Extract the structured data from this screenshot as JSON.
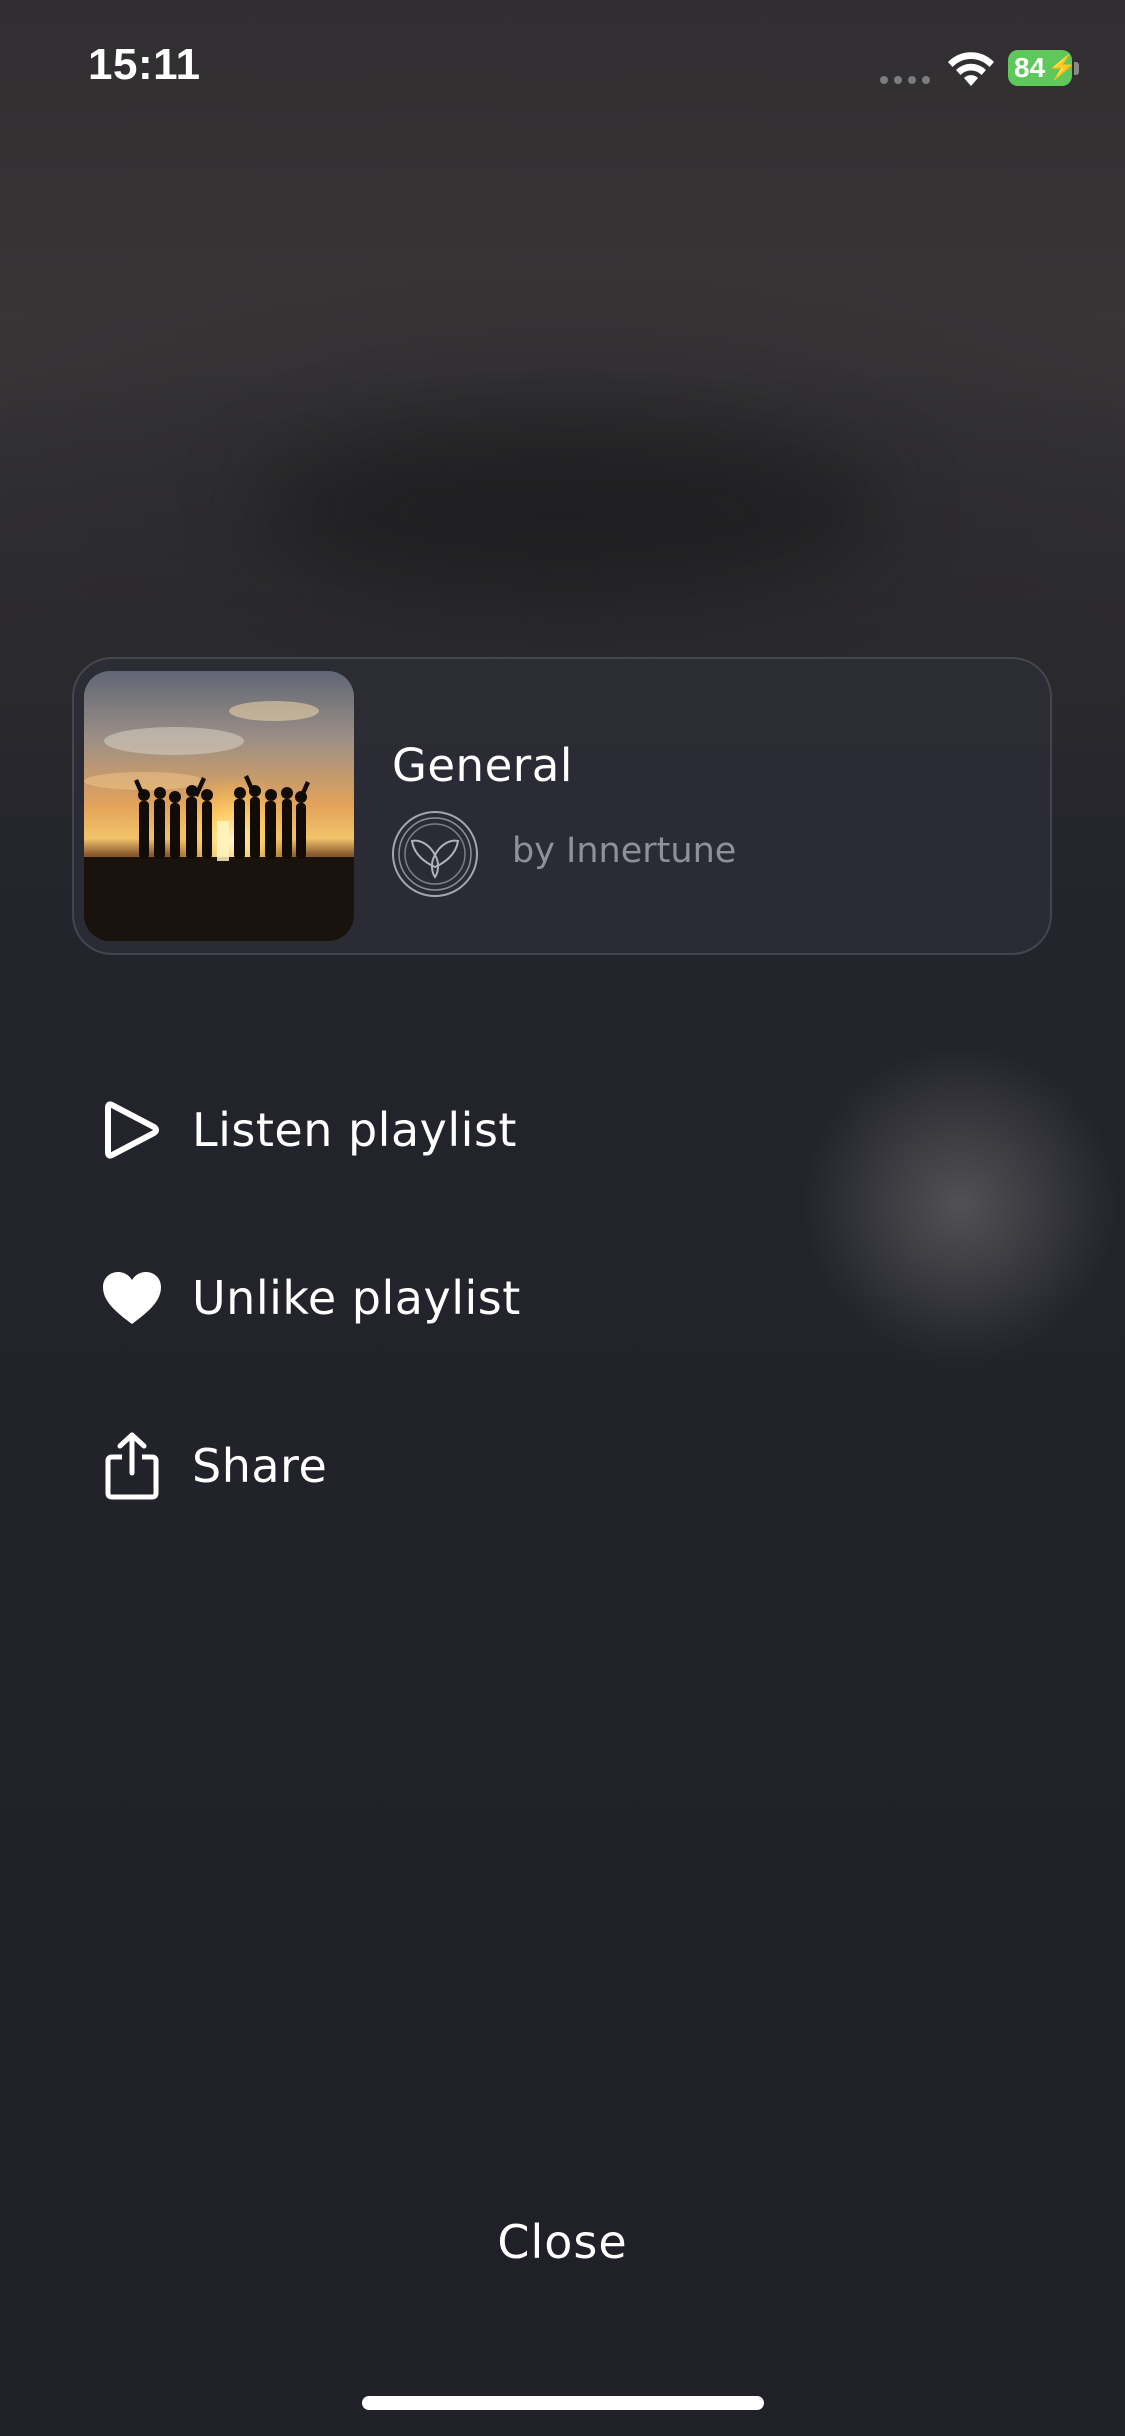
{
  "status_bar": {
    "time": "15:11",
    "battery_level": "84"
  },
  "playlist_card": {
    "title": "General",
    "author": "by Innertune",
    "thumbnail_icon": "sunset-group-photo",
    "avatar_icon": "innertune-logo-icon"
  },
  "menu": {
    "items": [
      {
        "label": "Listen playlist",
        "icon": "play-icon"
      },
      {
        "label": "Unlike playlist",
        "icon": "heart-icon"
      },
      {
        "label": "Share",
        "icon": "share-icon"
      }
    ]
  },
  "footer": {
    "close_label": "Close"
  },
  "colors": {
    "background": "#1f2029",
    "card_background": "#2c2e38",
    "secondary_text": "#8f909a",
    "battery": "#5fc85b"
  }
}
